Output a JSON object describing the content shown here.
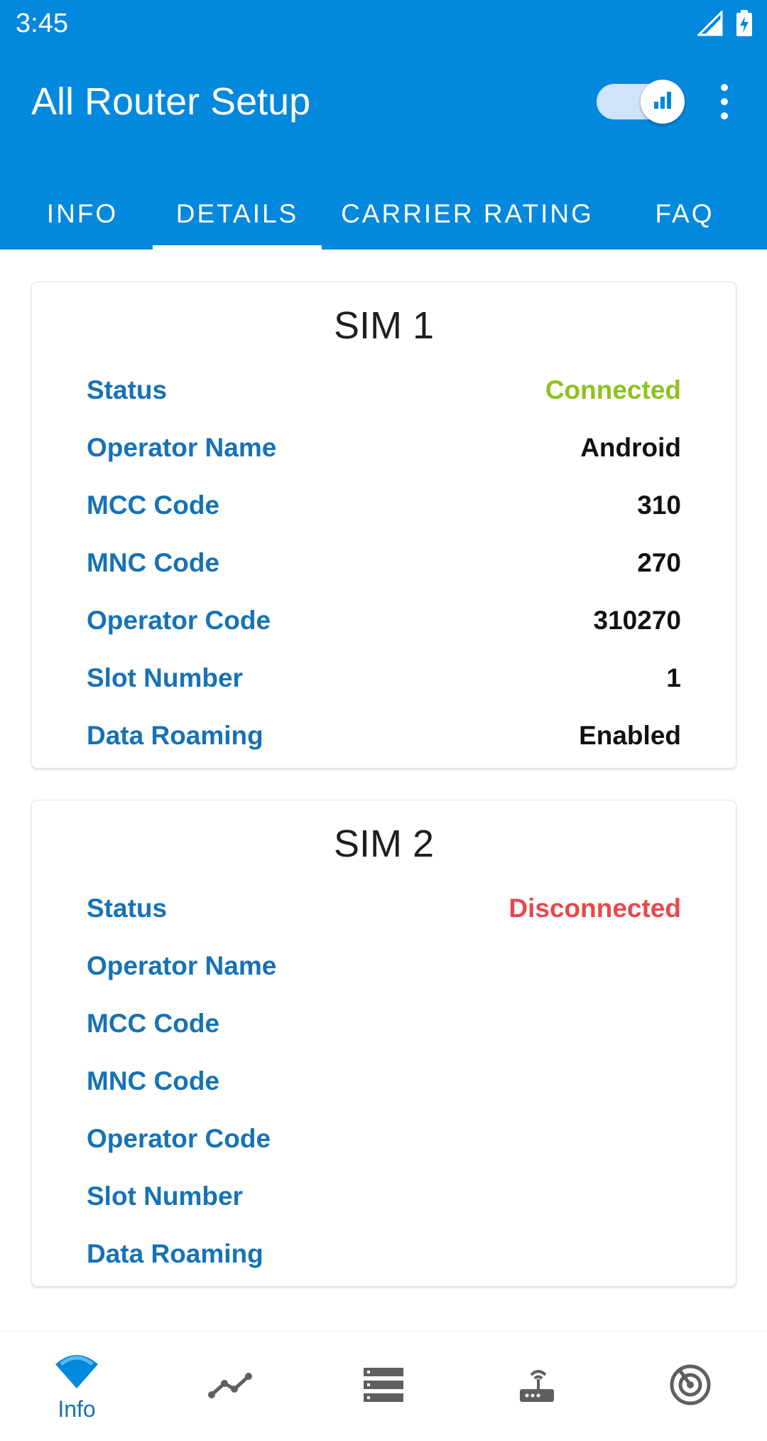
{
  "status_bar": {
    "time": "3:45",
    "signal_icon": "cell-signal-icon",
    "battery_icon": "battery-charging-icon"
  },
  "appbar": {
    "title": "All Router Setup",
    "toggle_icon": "signal-bars-icon",
    "overflow_icon": "more-vert-icon"
  },
  "tabs": [
    {
      "label": "INFO",
      "active": false
    },
    {
      "label": "DETAILS",
      "active": true
    },
    {
      "label": "CARRIER RATING",
      "active": false
    },
    {
      "label": "FAQ",
      "active": false
    }
  ],
  "sim1": {
    "title": "SIM 1",
    "rows": [
      {
        "label": "Status",
        "value": "Connected"
      },
      {
        "label": "Operator Name",
        "value": "Android"
      },
      {
        "label": "MCC Code",
        "value": "310"
      },
      {
        "label": "MNC Code",
        "value": "270"
      },
      {
        "label": "Operator Code",
        "value": "310270"
      },
      {
        "label": "Slot Number",
        "value": "1"
      },
      {
        "label": "Data Roaming",
        "value": "Enabled"
      }
    ]
  },
  "sim2": {
    "title": "SIM 2",
    "rows": [
      {
        "label": "Status",
        "value": "Disconnected"
      },
      {
        "label": "Operator Name",
        "value": ""
      },
      {
        "label": "MCC Code",
        "value": ""
      },
      {
        "label": "MNC Code",
        "value": ""
      },
      {
        "label": "Operator Code",
        "value": ""
      },
      {
        "label": "Slot Number",
        "value": ""
      },
      {
        "label": "Data Roaming",
        "value": ""
      }
    ]
  },
  "bottom_nav": [
    {
      "label": "Info",
      "icon": "wifi-icon",
      "active": true
    },
    {
      "label": "",
      "icon": "chart-line-icon",
      "active": false
    },
    {
      "label": "",
      "icon": "list-icon",
      "active": false
    },
    {
      "label": "",
      "icon": "router-icon",
      "active": false
    },
    {
      "label": "",
      "icon": "radar-icon",
      "active": false
    }
  ],
  "colors": {
    "primary": "#0288dd",
    "label_blue": "#1672b5",
    "connected": "#8dc21f",
    "disconnected": "#e8474c",
    "icon_gray": "#5f5f5f"
  }
}
